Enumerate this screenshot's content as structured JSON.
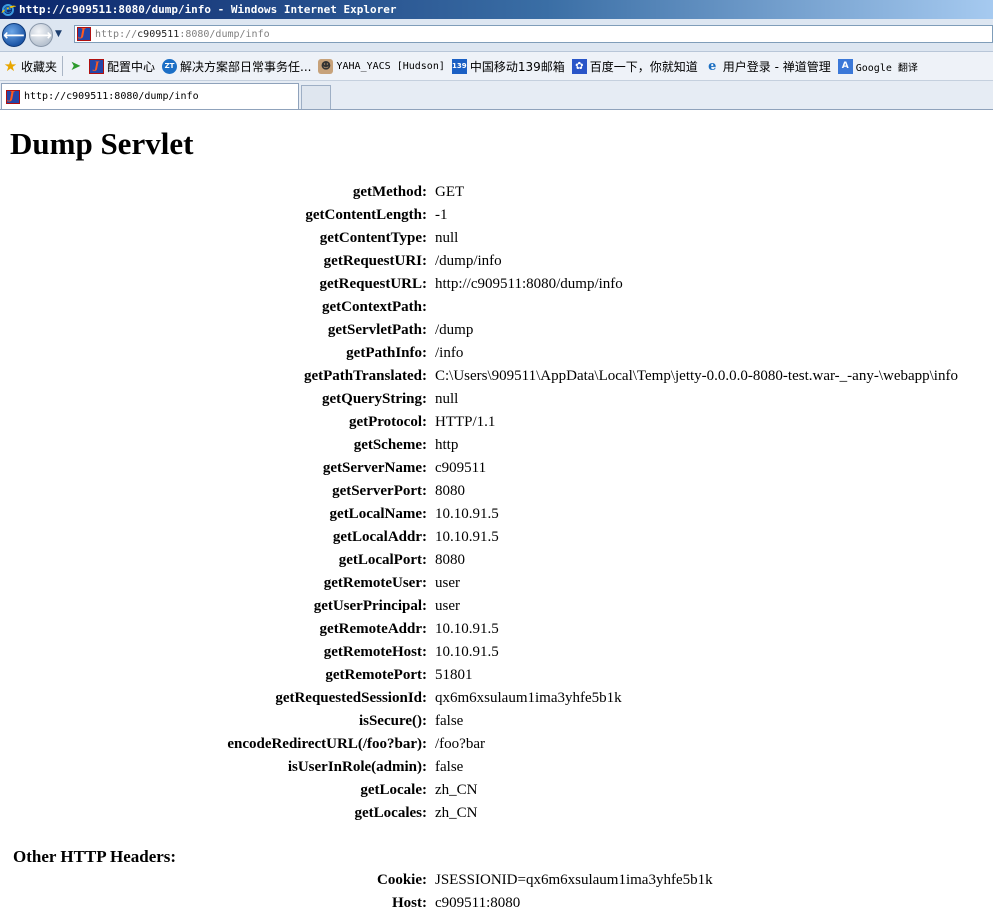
{
  "window": {
    "title": "http://c909511:8080/dump/info - Windows Internet Explorer"
  },
  "address_bar": {
    "url_prefix": "http://",
    "url_host": "c909511",
    "url_rest": ":8080/dump/info"
  },
  "favorites": [
    {
      "label": "收藏夹",
      "icon": "star-icon"
    },
    {
      "label": "配置中心",
      "icon": "jetty-icon"
    },
    {
      "label": "解决方案部日常事务任...",
      "icon": "zt-icon"
    },
    {
      "label": "YAHA_YACS [Hudson]",
      "icon": "hudson-icon"
    },
    {
      "label": "中国移动139邮箱",
      "icon": "mail139-icon"
    },
    {
      "label": "百度一下，你就知道",
      "icon": "baidu-icon"
    },
    {
      "label": "用户登录 - 禅道管理",
      "icon": "ie-page-icon"
    },
    {
      "label": "Google 翻译",
      "icon": "google-translate-icon"
    }
  ],
  "tab": {
    "label": "http://c909511:8080/dump/info"
  },
  "page": {
    "title": "Dump Servlet",
    "rows": [
      {
        "key": "getMethod:",
        "value": "GET"
      },
      {
        "key": "getContentLength:",
        "value": "-1"
      },
      {
        "key": "getContentType:",
        "value": "null"
      },
      {
        "key": "getRequestURI:",
        "value": "/dump/info"
      },
      {
        "key": "getRequestURL:",
        "value": "http://c909511:8080/dump/info"
      },
      {
        "key": "getContextPath:",
        "value": ""
      },
      {
        "key": "getServletPath:",
        "value": "/dump"
      },
      {
        "key": "getPathInfo:",
        "value": "/info"
      },
      {
        "key": "getPathTranslated:",
        "value": "C:\\Users\\909511\\AppData\\Local\\Temp\\jetty-0.0.0.0-8080-test.war-_-any-\\webapp\\info"
      },
      {
        "key": "getQueryString:",
        "value": "null"
      },
      {
        "key": "getProtocol:",
        "value": "HTTP/1.1"
      },
      {
        "key": "getScheme:",
        "value": "http"
      },
      {
        "key": "getServerName:",
        "value": "c909511"
      },
      {
        "key": "getServerPort:",
        "value": "8080"
      },
      {
        "key": "getLocalName:",
        "value": "10.10.91.5"
      },
      {
        "key": "getLocalAddr:",
        "value": "10.10.91.5"
      },
      {
        "key": "getLocalPort:",
        "value": "8080"
      },
      {
        "key": "getRemoteUser:",
        "value": "user"
      },
      {
        "key": "getUserPrincipal:",
        "value": "user"
      },
      {
        "key": "getRemoteAddr:",
        "value": "10.10.91.5"
      },
      {
        "key": "getRemoteHost:",
        "value": "10.10.91.5"
      },
      {
        "key": "getRemotePort:",
        "value": "51801"
      },
      {
        "key": "getRequestedSessionId:",
        "value": "qx6m6xsulaum1ima3yhfe5b1k"
      },
      {
        "key": "isSecure():",
        "value": "false"
      },
      {
        "key": "encodeRedirectURL(/foo?bar):",
        "value": "/foo?bar"
      },
      {
        "key": "isUserInRole(admin):",
        "value": "false"
      },
      {
        "key": "getLocale:",
        "value": "zh_CN"
      },
      {
        "key": "getLocales:",
        "value": "zh_CN"
      }
    ],
    "headers_title": "Other HTTP Headers:",
    "headers": [
      {
        "key": "Cookie:",
        "value": "JSESSIONID=qx6m6xsulaum1ima3yhfe5b1k"
      },
      {
        "key": "Host:",
        "value": "c909511:8080"
      }
    ]
  }
}
